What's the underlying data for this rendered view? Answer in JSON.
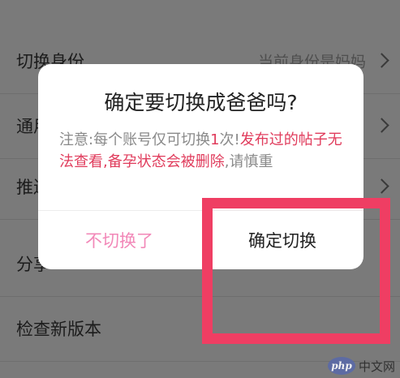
{
  "settings": {
    "rows": [
      {
        "label": "切换身份",
        "value": "当前身份是妈妈"
      },
      {
        "label": "通用",
        "value": ""
      },
      {
        "label": "推送",
        "value": ""
      },
      {
        "label": "分享",
        "value": ""
      },
      {
        "label": "检查新版本",
        "value": ""
      }
    ]
  },
  "dialog": {
    "title": "确定要切换成爸爸吗?",
    "message_gray_1": "注意:每个账号仅可切换",
    "message_count": "1",
    "message_gray_2": "次!",
    "message_red": "发布过的帖子无法查看,备孕状态会被删除",
    "message_gray_3": ",请慎重",
    "cancel_label": "不切换了",
    "confirm_label": "确定切换"
  },
  "watermark": {
    "logo": "php",
    "text": "中文网"
  },
  "colors": {
    "highlight": "#ef3e63",
    "cancel_text": "#f288b8",
    "warning_red": "#e03c5c"
  }
}
